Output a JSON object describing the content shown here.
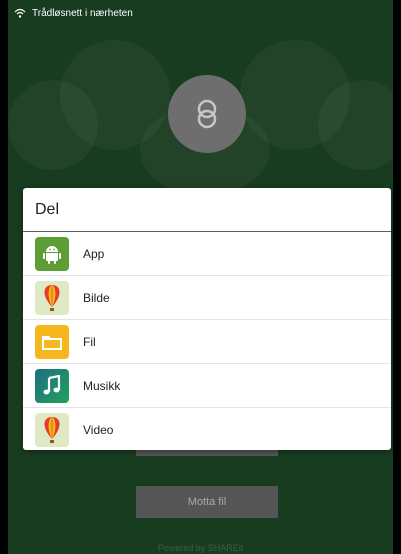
{
  "status_bar": {
    "text": "Trådløsnett i nærheten",
    "icon": "wifi-icon"
  },
  "dialog": {
    "title": "Del",
    "items": [
      {
        "label": "App",
        "icon": "android-icon",
        "color": "#5e9d36"
      },
      {
        "label": "Bilde",
        "icon": "balloon-icon",
        "color": "#cfe2a8"
      },
      {
        "label": "Fil",
        "icon": "folder-icon",
        "color": "#f5b71d"
      },
      {
        "label": "Musikk",
        "icon": "music-note-icon",
        "color": "#1e8a5a"
      },
      {
        "label": "Video",
        "icon": "balloon-icon",
        "color": "#cfe2a8"
      }
    ]
  },
  "receive_button": {
    "label": "Motta fil"
  },
  "footer": {
    "text": "Powered by SHAREit"
  },
  "colors": {
    "background": "#1f4d28",
    "button": "#6d6d6d"
  }
}
